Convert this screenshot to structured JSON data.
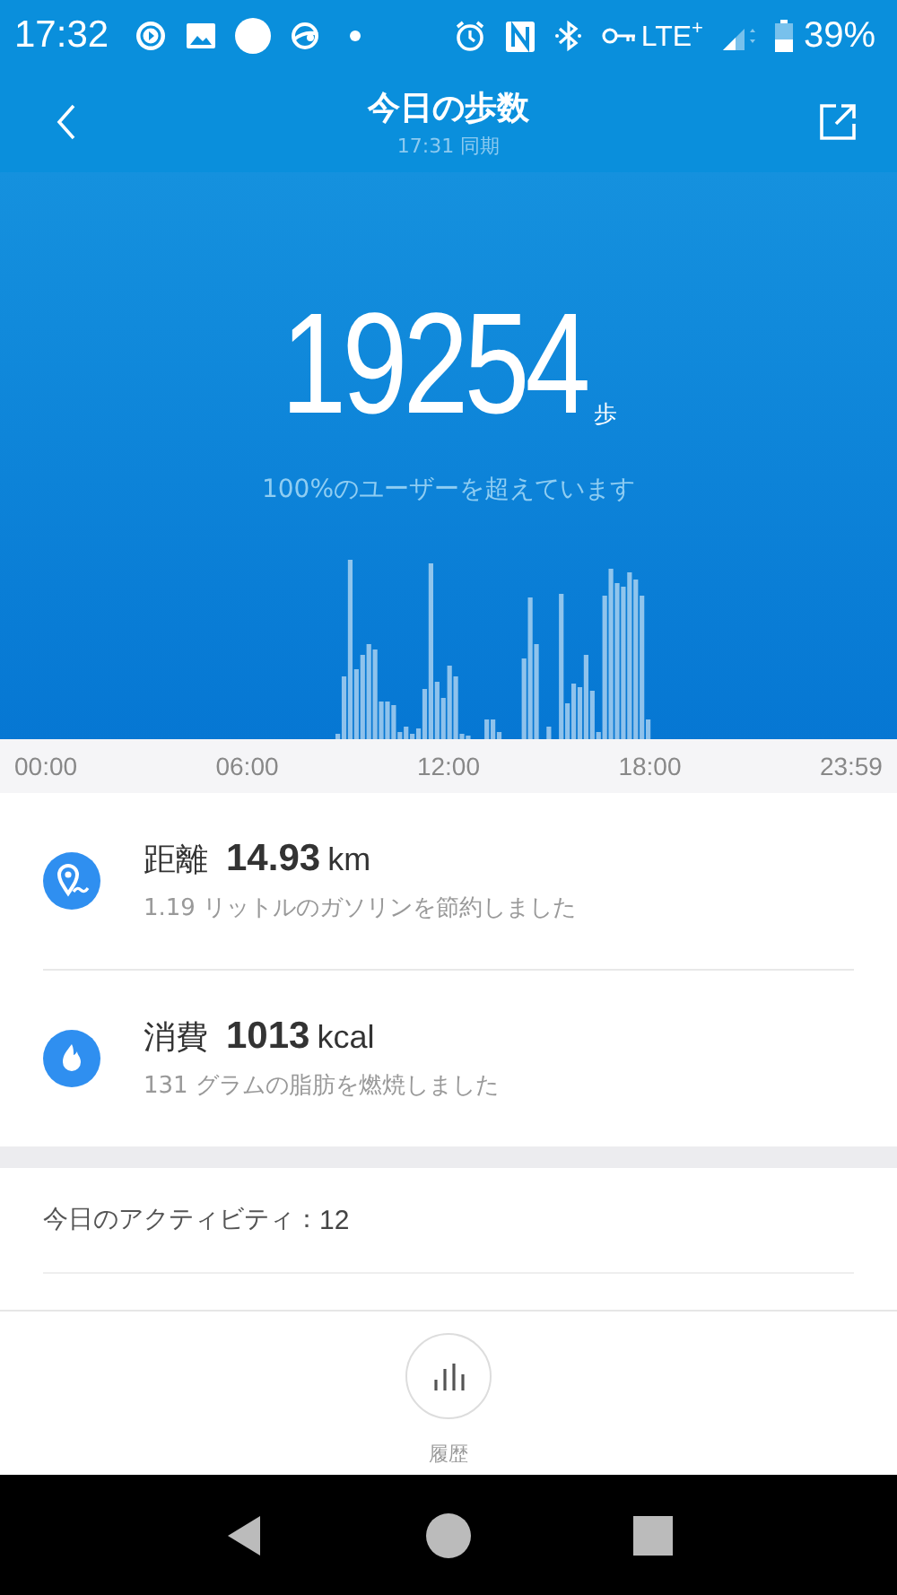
{
  "status_bar": {
    "time": "17:32",
    "network": "LTE$^{+}$",
    "battery": "39%"
  },
  "header": {
    "title": "今日の歩数",
    "subtitle": "17:31 同期"
  },
  "summary": {
    "steps": "19254",
    "unit": "歩",
    "note": "100%のユーザーを超えています"
  },
  "chart": {
    "x_labels": [
      "00:00",
      "06:00",
      "12:00",
      "18:00",
      "23:59"
    ]
  },
  "stats": [
    {
      "kind": "distance",
      "label": "距離",
      "value": "14.93",
      "unit": "km",
      "note": "1.19 リットルのガソリンを節約しました"
    },
    {
      "kind": "calories",
      "label": "消費",
      "value": "1013",
      "unit": "kcal",
      "note": "131 グラムの脂肪を燃焼しました"
    }
  ],
  "activity": {
    "label": "今日のアクティビティ：",
    "count": "12"
  },
  "history_button": {
    "label": "履歴"
  }
}
